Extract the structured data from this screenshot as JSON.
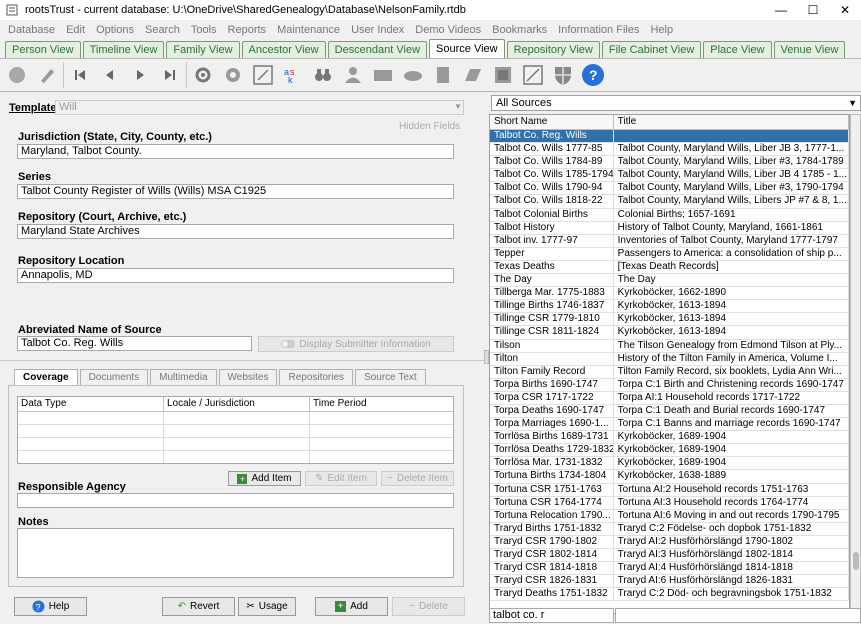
{
  "window": {
    "title": "rootsTrust - current database: U:\\OneDrive\\SharedGenealogy\\Database\\NelsonFamily.rtdb",
    "minimize": "—",
    "maximize": "☐",
    "close": "✕"
  },
  "menu": [
    "Database",
    "Edit",
    "Options",
    "Search",
    "Tools",
    "Reports",
    "Maintenance",
    "User Index",
    "Demo Videos",
    "Bookmarks",
    "Information Files",
    "Help"
  ],
  "tabs": [
    "Person View",
    "Timeline View",
    "Family View",
    "Ancestor View",
    "Descendant View",
    "Source View",
    "Repository View",
    "File Cabinet View",
    "Place View",
    "Venue View"
  ],
  "active_tab": "Source View",
  "template": {
    "label": "Template:",
    "value": "Will",
    "hidden_fields": "Hidden Fields"
  },
  "fields": {
    "jurisdiction": {
      "label": "Jurisdiction (State, City, County, etc.)",
      "value": "Maryland, Talbot County."
    },
    "series": {
      "label": "Series",
      "value": "Talbot County Register of Wills (Wills) MSA C1925"
    },
    "repository": {
      "label": "Repository (Court, Archive, etc.)",
      "value": "Maryland State Archives"
    },
    "repo_location": {
      "label": "Repository Location",
      "value": "Annapolis, MD"
    },
    "abbrev": {
      "label": "Abreviated Name of Source",
      "value": "Talbot Co. Reg. Wills"
    }
  },
  "display_submitter": "Display Submitter Information",
  "subtabs": [
    "Coverage",
    "Documents",
    "Multimedia",
    "Websites",
    "Repositories",
    "Source Text"
  ],
  "coverage": {
    "columns": [
      "Data Type",
      "Locale / Jurisdiction",
      "Time Period"
    ],
    "add_item": "Add Item",
    "edit_item": "Edit Item",
    "delete_item": "Delete Item"
  },
  "responsible_agency": {
    "label": "Responsible Agency",
    "value": ""
  },
  "notes": {
    "label": "Notes",
    "value": ""
  },
  "bottom_buttons": {
    "help": "Help",
    "revert": "Revert",
    "usage": "Usage",
    "add": "Add",
    "delete": "Delete"
  },
  "sources_filter": "All Sources",
  "sources_columns": [
    "Short Name",
    "Title"
  ],
  "sources": [
    [
      "Talbot Co. Reg. Wills",
      ""
    ],
    [
      "Talbot Co. Wills 1777-85",
      "Talbot County, Maryland Wills, Liber JB 3, 1777-1..."
    ],
    [
      "Talbot Co. Wills 1784-89",
      "Talbot County, Maryland Wills, Liber #3, 1784-1789"
    ],
    [
      "Talbot Co. Wills 1785-1794",
      "Talbot County, Maryland Wills, Liber JB 4 1785 - 1..."
    ],
    [
      "Talbot Co. Wills 1790-94",
      "Talbot County, Maryland Wills, Liber #3, 1790-1794"
    ],
    [
      "Talbot Co. Wills 1818-22",
      "Talbot County, Maryland Wills, Libers JP #7 & 8, 1..."
    ],
    [
      "Talbot Colonial Births",
      "Colonial Births; 1657-1691"
    ],
    [
      "Talbot History",
      "History of Talbot County, Maryland, 1661-1861"
    ],
    [
      "Talbot inv. 1777-97",
      "Inventories of Talbot County, Maryland 1777-1797"
    ],
    [
      "Tepper",
      "Passengers to America: a consolidation of ship p..."
    ],
    [
      "Texas Deaths",
      "[Texas Death Records]"
    ],
    [
      "The Day",
      "The Day"
    ],
    [
      "Tillberga Mar. 1775-1883",
      "Kyrkoböcker, 1662-1890"
    ],
    [
      "Tillinge Births 1746-1837",
      "Kyrkoböcker, 1613-1894"
    ],
    [
      "Tillinge CSR 1779-1810",
      "Kyrkoböcker, 1613-1894"
    ],
    [
      "Tillinge CSR 1811-1824",
      "Kyrkoböcker, 1613-1894"
    ],
    [
      "Tilson",
      "The Tilson Genealogy from Edmond Tilson at Ply..."
    ],
    [
      "Tilton",
      "History of the Tilton Family in America, Volume I..."
    ],
    [
      "Tilton Family Record",
      "Tilton Family Record, six booklets, Lydia Ann Wri..."
    ],
    [
      "Torpa Births 1690-1747",
      "Torpa C:1 Birth and Christening records 1690-1747"
    ],
    [
      "Torpa CSR 1717-1722",
      "Torpa AI:1 Household records 1717-1722"
    ],
    [
      "Torpa Deaths 1690-1747",
      "Torpa C:1 Death and Burial records 1690-1747"
    ],
    [
      "Torpa Marriages 1690-1...",
      "Torpa C:1 Banns and marriage records 1690-1747"
    ],
    [
      "Torrlösa Births 1689-1731",
      "Kyrkoböcker, 1689-1904"
    ],
    [
      "Torrlösa Deaths 1729-1832",
      "Kyrkoböcker, 1689-1904"
    ],
    [
      "Torrlösa Mar. 1731-1832",
      "Kyrkoböcker, 1689-1904"
    ],
    [
      "Tortuna Births 1734-1804",
      "Kyrkoböcker, 1638-1889"
    ],
    [
      "Tortuna CSR 1751-1763",
      "Tortuna AI:2 Household records 1751-1763"
    ],
    [
      "Tortuna CSR 1764-1774",
      "Tortuna AI:3 Household records 1764-1774"
    ],
    [
      "Tortuna Relocation 1790...",
      "Tortuna AI:6 Moving in and out records 1790-1795"
    ],
    [
      "Traryd Births 1751-1832",
      "Traryd C:2 Födelse- och dopbok 1751-1832"
    ],
    [
      "Traryd CSR 1790-1802",
      "Traryd AI:2 Husförhörslängd 1790-1802"
    ],
    [
      "Traryd CSR 1802-1814",
      "Traryd AI:3 Husförhörslängd 1802-1814"
    ],
    [
      "Traryd CSR 1814-1818",
      "Traryd AI:4 Husförhörslängd 1814-1818"
    ],
    [
      "Traryd CSR 1826-1831",
      "Traryd AI:6 Husförhörslängd 1826-1831"
    ],
    [
      "Traryd Deaths 1751-1832",
      "Traryd C:2 Död- och begravningsbok 1751-1832"
    ]
  ],
  "search_value": "talbot co. r"
}
